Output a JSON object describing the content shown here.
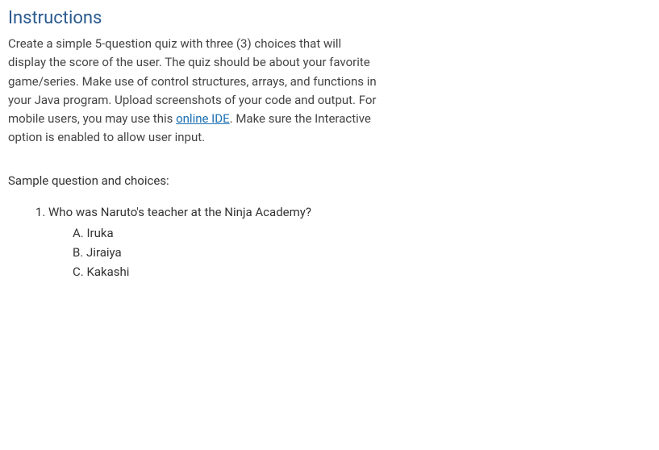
{
  "heading": "Instructions",
  "intro": {
    "text_before_link": "Create a simple 5-question quiz with three (3) choices that will display the score of the user. The quiz should be about your favorite game/series. Make use of control structures, arrays, and functions in your Java program. Upload screenshots of your code and output. For mobile users, you may use this ",
    "link_text": "online IDE",
    "text_after_link": ". Make sure the Interactive option is enabled to allow user input."
  },
  "sample_label": "Sample question and choices:",
  "question": {
    "text": "Who was Naruto's teacher at the Ninja Academy?",
    "choices": {
      "a": "A. Iruka",
      "b": "B. Jiraiya",
      "c": "C. Kakashi"
    }
  }
}
